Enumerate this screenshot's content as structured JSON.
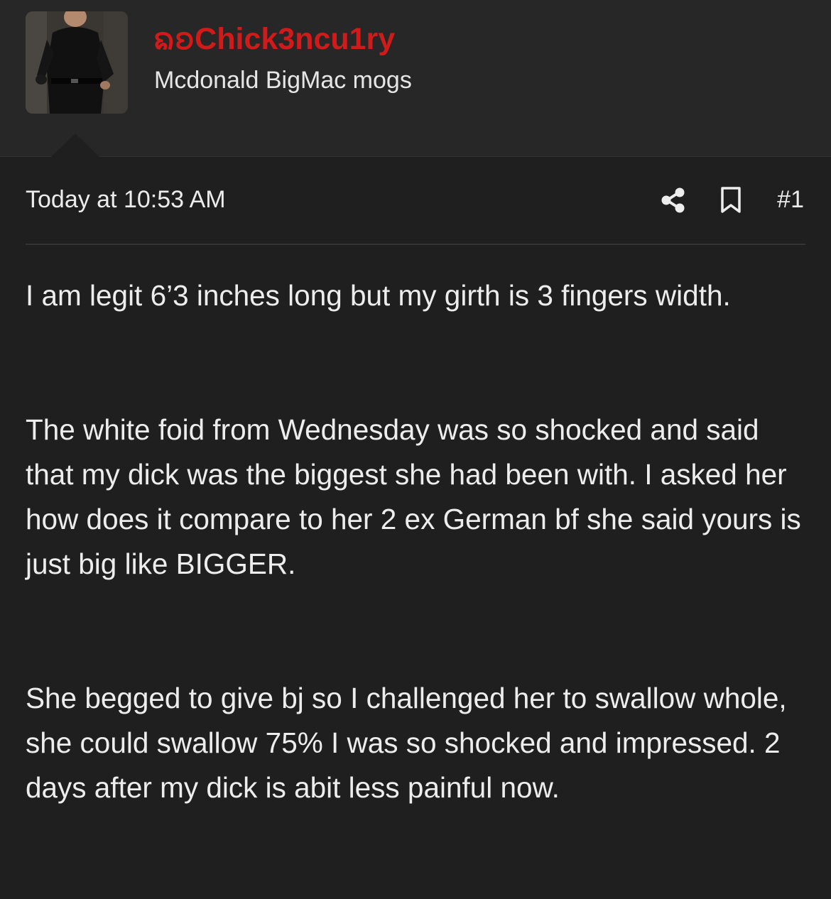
{
  "user": {
    "name": "ᨦᨧChick3ncu1ry",
    "title": "Mcdonald BigMac mogs",
    "name_color": "#d11a1a"
  },
  "post": {
    "timestamp": "Today at 10:53 AM",
    "number": "#1",
    "actions": {
      "share_icon": "share-icon",
      "bookmark_icon": "bookmark-icon"
    },
    "paragraphs": [
      "I am legit 6’3 inches long but my girth is 3 fingers width.",
      "The white foid from Wednesday was so shocked and said that my dick was the biggest she had been with. I asked her how does it compare to her 2 ex German bf she said yours is just big like BIGGER.",
      "She begged to give bj so I challenged her to swallow whole, she could swallow 75% I was so shocked and impressed. 2 days after my dick is abit less painful now."
    ]
  },
  "theme": {
    "background": "#1f1f1f",
    "header_background": "#272727",
    "text": "#ededed"
  }
}
